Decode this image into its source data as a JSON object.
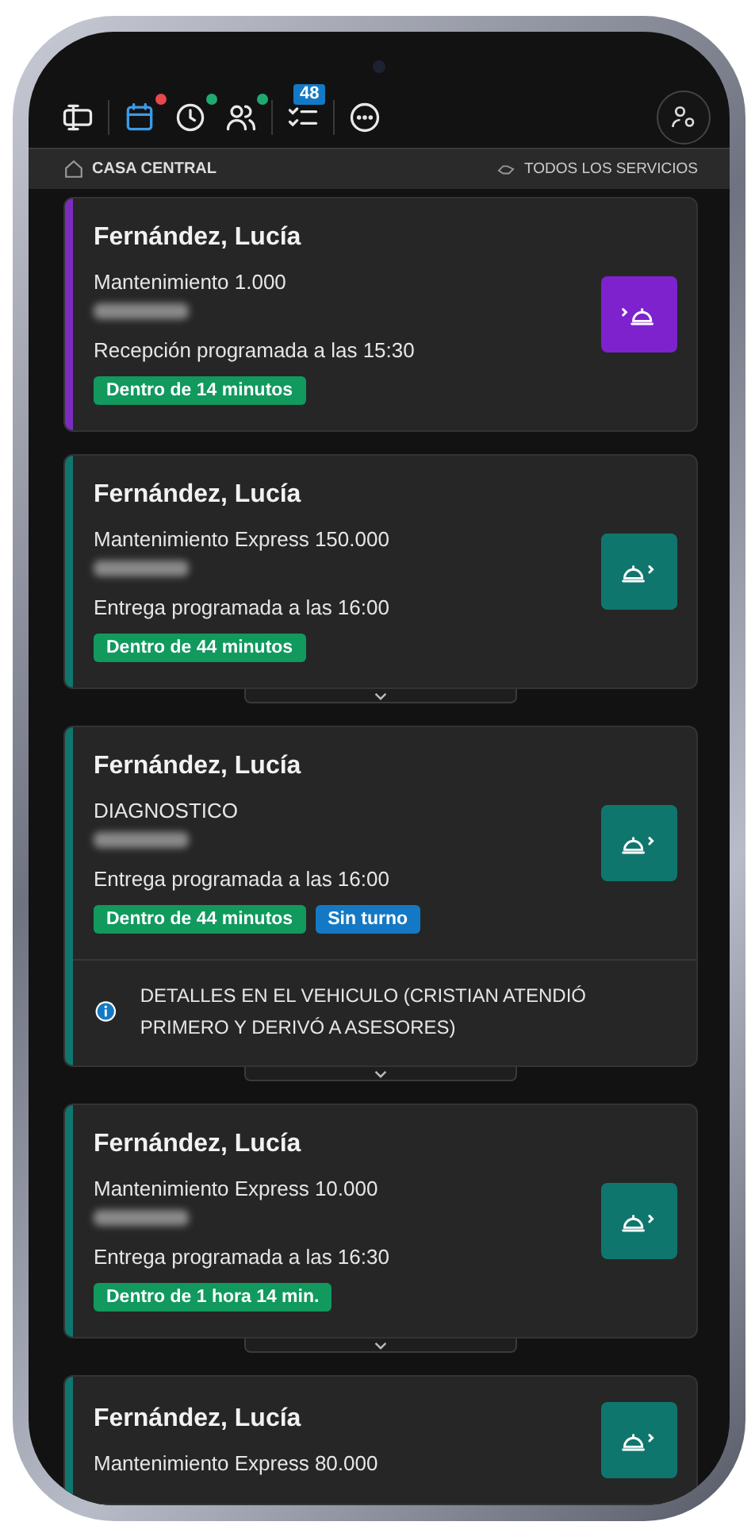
{
  "toolbar": {
    "tools": [
      {
        "selected": false
      },
      {
        "selected": true,
        "color": "#e5484d"
      },
      {
        "selected": false,
        "color": "#1fa971"
      },
      {
        "selected": false,
        "color": "#1fa971"
      },
      {
        "selected": false,
        "badge": "48"
      },
      {
        "selected": false
      }
    ]
  },
  "location": {
    "branch": "CASA CENTRAL",
    "filter": "TODOS LOS SERVICIOS"
  },
  "cards": [
    {
      "kind": "reception",
      "color": "#7b2cbf",
      "customer": "Fernández, Lucía",
      "service": "Mantenimiento 1.000",
      "plate_hidden": true,
      "schedule": "Recepción programada a las 15:30",
      "tags": [
        {
          "text": "Dentro de 14 minutos",
          "color": "#11995e"
        }
      ],
      "expandable": false
    },
    {
      "kind": "delivery",
      "color": "#0f766e",
      "customer": "Fernández, Lucía",
      "service": "Mantenimiento Express 150.000",
      "plate_hidden": true,
      "schedule": "Entrega programada a las 16:00",
      "tags": [
        {
          "text": "Dentro de 44 minutos",
          "color": "#11995e"
        }
      ],
      "expandable": true
    },
    {
      "kind": "delivery",
      "color": "#0f766e",
      "customer": "Fernández, Lucía",
      "service": "DIAGNOSTICO",
      "plate_hidden": true,
      "schedule": "Entrega programada a las 16:00",
      "tags": [
        {
          "text": "Dentro de 44 minutos",
          "color": "#11995e"
        },
        {
          "text": "Sin turno",
          "color": "#1479c4"
        }
      ],
      "note": "DETALLES EN EL VEHICULO (CRISTIAN ATENDIÓ PRIMERO Y DERIVÓ A ASESORES)",
      "expandable": true
    },
    {
      "kind": "delivery",
      "color": "#0f766e",
      "customer": "Fernández, Lucía",
      "service": "Mantenimiento Express 10.000",
      "plate_hidden": true,
      "schedule": "Entrega programada a las 16:30",
      "tags": [
        {
          "text": "Dentro de 1 hora 14 min.",
          "color": "#11995e"
        }
      ],
      "expandable": true
    },
    {
      "kind": "delivery",
      "color": "#0f766e",
      "customer": "Fernández, Lucía",
      "service": "Mantenimiento Express 80.000",
      "expandable": false
    }
  ]
}
